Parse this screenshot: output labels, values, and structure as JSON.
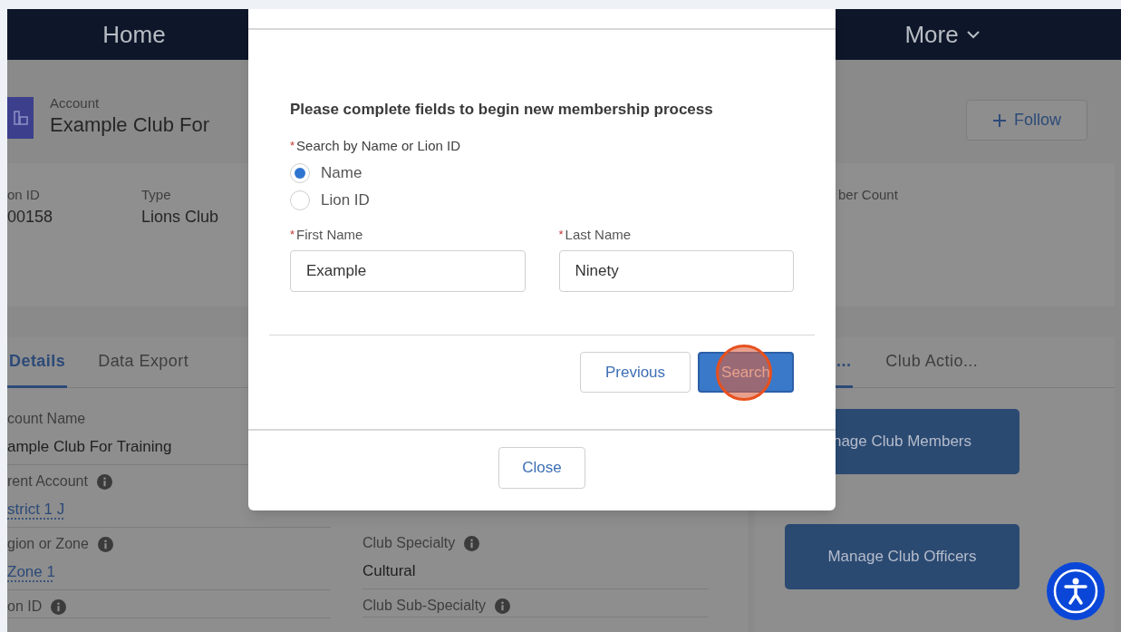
{
  "nav": {
    "items": [
      {
        "label": "Home"
      },
      {
        "label": "More",
        "dropdown": true
      }
    ]
  },
  "record_header": {
    "object_type": "Account",
    "title": "Example Club For",
    "follow_button": "Follow"
  },
  "highlights": [
    {
      "label": "on ID",
      "value": "00158"
    },
    {
      "label": "Type",
      "value": "Lions Club"
    },
    {
      "label": "ber Count"
    }
  ],
  "details_card": {
    "tabs": [
      {
        "label": "Details",
        "selected": true
      },
      {
        "label": "Data Export",
        "selected": false
      }
    ],
    "left_fields": [
      {
        "label": "count Name",
        "value": "ample Club For Training",
        "link": false
      },
      {
        "label": "rent Account",
        "value": "strict 1 J",
        "link": true,
        "info": true
      },
      {
        "label": "gion or Zone",
        "value": "Zone 1",
        "link": true,
        "info": true
      },
      {
        "label": "on ID",
        "info": true
      }
    ],
    "right_fields": [
      {
        "label": "Club Specialty",
        "value": "Cultural",
        "link": false,
        "info": true
      },
      {
        "label": "Club Sub-Specialty",
        "info": true
      }
    ]
  },
  "actions_card": {
    "tabs": [
      {
        "label": "...",
        "selected": true
      },
      {
        "label": "Club Actio...",
        "selected": false
      }
    ],
    "buttons": [
      "nage Club Members",
      "Manage Club Officers"
    ]
  },
  "modal": {
    "heading": "Please complete fields to begin new membership process",
    "radio_group": {
      "label": "Search by Name or Lion ID",
      "required_mark": "*",
      "options": [
        {
          "label": "Name",
          "selected": true
        },
        {
          "label": "Lion ID",
          "selected": false
        }
      ]
    },
    "fields": [
      {
        "label": "First Name",
        "required_mark": "*",
        "value": "Example"
      },
      {
        "label": "Last Name",
        "required_mark": "*",
        "value": "Ninety"
      }
    ],
    "buttons": [
      {
        "label": "Previous",
        "kind": "neutral"
      },
      {
        "label": "Search",
        "kind": "brand",
        "highlighted": true
      }
    ],
    "close_button": "Close"
  }
}
